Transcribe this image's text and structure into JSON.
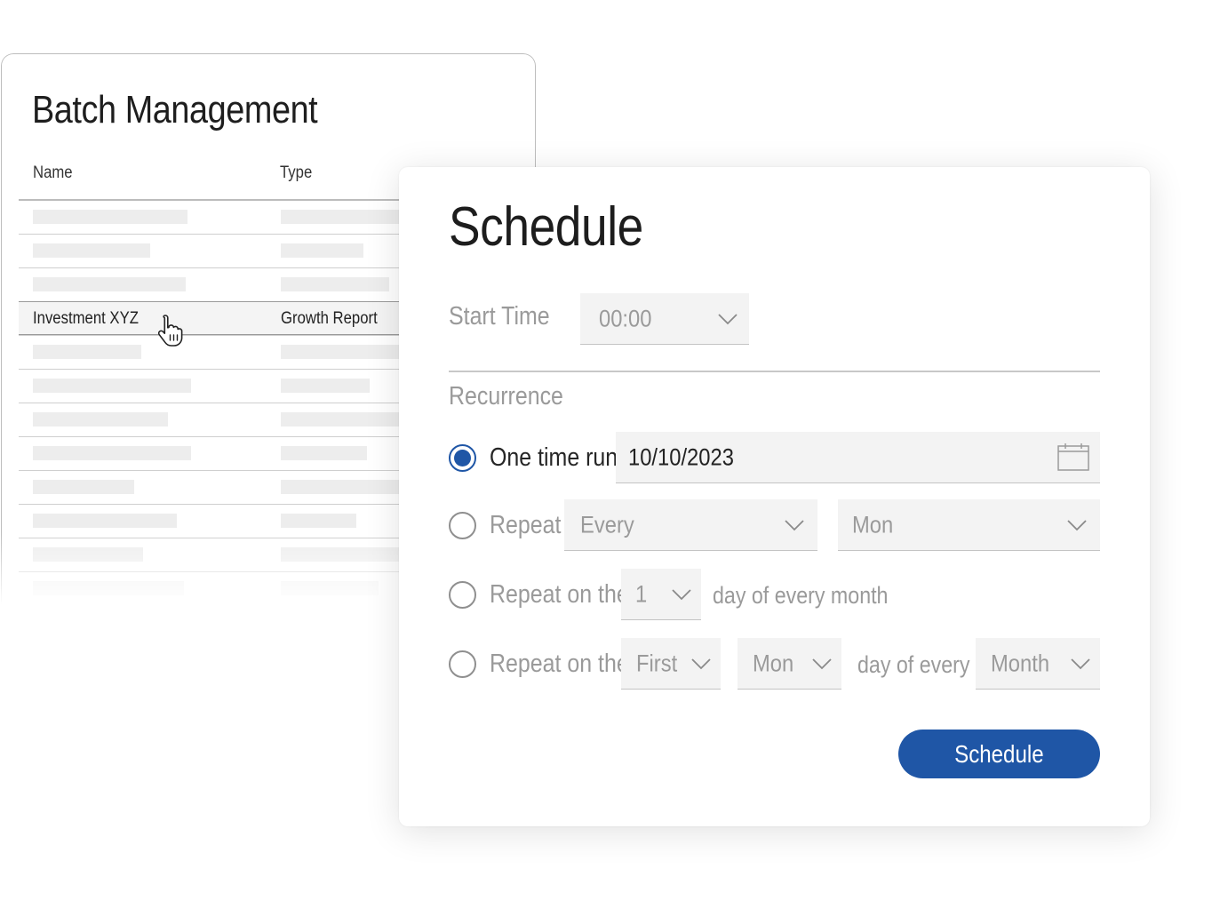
{
  "batch": {
    "title": "Batch Management",
    "columns": {
      "name": "Name",
      "type": "Type"
    },
    "selected_row": {
      "name": "Investment XYZ",
      "type": "Growth Report"
    }
  },
  "schedule": {
    "title": "Schedule",
    "start_time": {
      "label": "Start Time",
      "value": "00:00"
    },
    "recurrence": {
      "label": "Recurrence",
      "one_time": {
        "label": "One time run",
        "date": "10/10/2023",
        "checked": true
      },
      "repeat": {
        "label": "Repeat",
        "frequency": "Every",
        "day": "Mon"
      },
      "repeat_day_of_month": {
        "label": "Repeat on the",
        "day": "1",
        "suffix": "day of every month"
      },
      "repeat_weekday_of_month": {
        "label": "Repeat on the",
        "ordinal": "First",
        "day": "Mon",
        "middle": "day of every",
        "period": "Month"
      }
    },
    "submit_label": "Schedule"
  },
  "colors": {
    "accent": "#1f56a6",
    "muted_text": "#9a9a9a",
    "field_bg": "#f3f3f3"
  },
  "icons": {
    "cursor": "hand-pointer-icon",
    "calendar": "calendar-icon",
    "dropdown": "chevron-down-icon"
  }
}
